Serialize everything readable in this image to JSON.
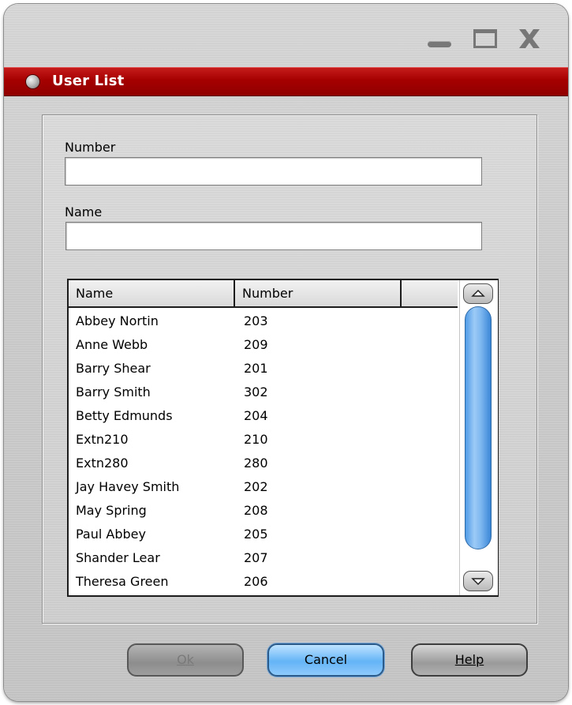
{
  "window": {
    "title": "User List",
    "controls": [
      "minimize-icon",
      "maximize-icon",
      "close-icon"
    ]
  },
  "form": {
    "number_label": "Number",
    "number_value": "",
    "name_label": "Name",
    "name_value": ""
  },
  "list": {
    "columns": [
      "Name",
      "Number",
      ""
    ],
    "rows": [
      {
        "name": "Abbey Nortin",
        "number": "203"
      },
      {
        "name": "Anne Webb",
        "number": "209"
      },
      {
        "name": "Barry Shear",
        "number": "201"
      },
      {
        "name": "Barry Smith",
        "number": "302"
      },
      {
        "name": "Betty Edmunds",
        "number": "204"
      },
      {
        "name": "Extn210",
        "number": "210"
      },
      {
        "name": "Extn280",
        "number": "280"
      },
      {
        "name": "Jay Havey Smith",
        "number": "202"
      },
      {
        "name": "May Spring",
        "number": "208"
      },
      {
        "name": "Paul Abbey",
        "number": "205"
      },
      {
        "name": "Shander Lear",
        "number": "207"
      },
      {
        "name": "Theresa Green",
        "number": "206"
      }
    ]
  },
  "buttons": {
    "ok_label": "Ok",
    "cancel_label": "Cancel",
    "help_label": "Help",
    "ok_enabled": false
  },
  "colors": {
    "titlebar": "#a50000",
    "scroll_thumb": "#7fb8f1",
    "cancel_button": "#64b4f6"
  }
}
